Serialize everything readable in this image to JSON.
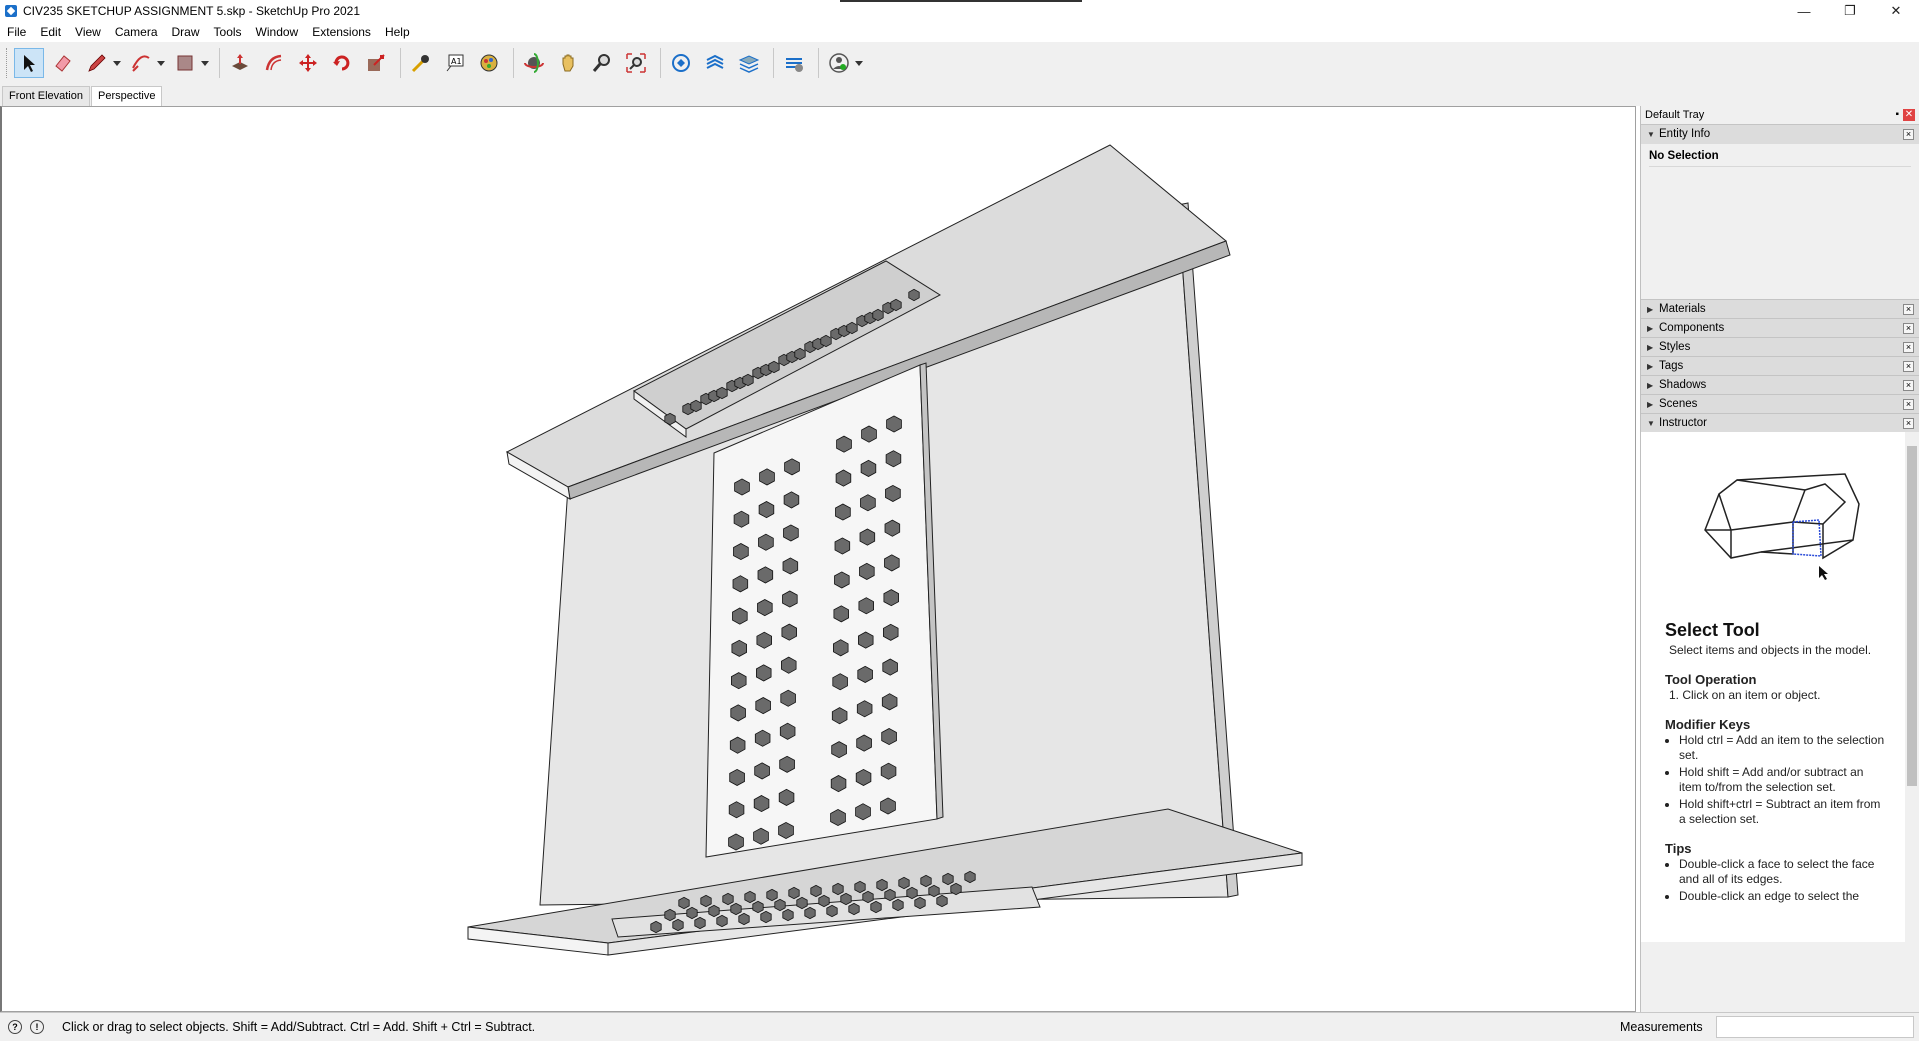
{
  "window": {
    "title": "CIV235 SKETCHUP ASSIGNMENT 5.skp - SketchUp Pro 2021",
    "minimize": "—",
    "restore": "❐",
    "close": "✕"
  },
  "menu": [
    "File",
    "Edit",
    "View",
    "Camera",
    "Draw",
    "Tools",
    "Window",
    "Extensions",
    "Help"
  ],
  "toolbar": {
    "tools": [
      "select-tool",
      "eraser-tool",
      "line-tool",
      "arc-tool",
      "rectangle-tool",
      "push-pull-tool",
      "offset-tool",
      "move-tool",
      "rotate-tool",
      "scale-tool",
      "tape-measure-tool",
      "text-tool",
      "paint-bucket-tool",
      "orbit-tool",
      "pan-tool",
      "zoom-tool",
      "zoom-extents-tool",
      "3d-warehouse",
      "extension-warehouse",
      "layer-manager",
      "style-builder",
      "account"
    ],
    "active": "select-tool"
  },
  "scenes": {
    "tabs": [
      "Front Elevation",
      "Perspective"
    ],
    "selected": "Perspective"
  },
  "tray": {
    "title": "Default Tray",
    "pin": "📌",
    "close": "✕",
    "entity_info": {
      "label": "Entity Info",
      "value": "No Selection"
    },
    "panels": [
      "Materials",
      "Components",
      "Styles",
      "Tags",
      "Shadows",
      "Scenes"
    ],
    "instructor": {
      "label": "Instructor",
      "heading": "Select Tool",
      "intro": "Select items and objects in the model.",
      "op_title": "Tool Operation",
      "op_step": "1. Click on an item or object.",
      "mod_title": "Modifier Keys",
      "mods": [
        "Hold ctrl = Add an item to the selection set.",
        "Hold shift = Add and/or subtract an item to/from the selection set.",
        "Hold shift+ctrl = Subtract an item from a selection set."
      ],
      "tips_title": "Tips",
      "tips": [
        "Double-click a face to select the face and all of its edges.",
        "Double-click an edge to select the"
      ]
    }
  },
  "status": {
    "message": "Click or drag to select objects. Shift = Add/Subtract. Ctrl = Add. Shift + Ctrl = Subtract.",
    "measurements_label": "Measurements",
    "measurements_value": ""
  }
}
